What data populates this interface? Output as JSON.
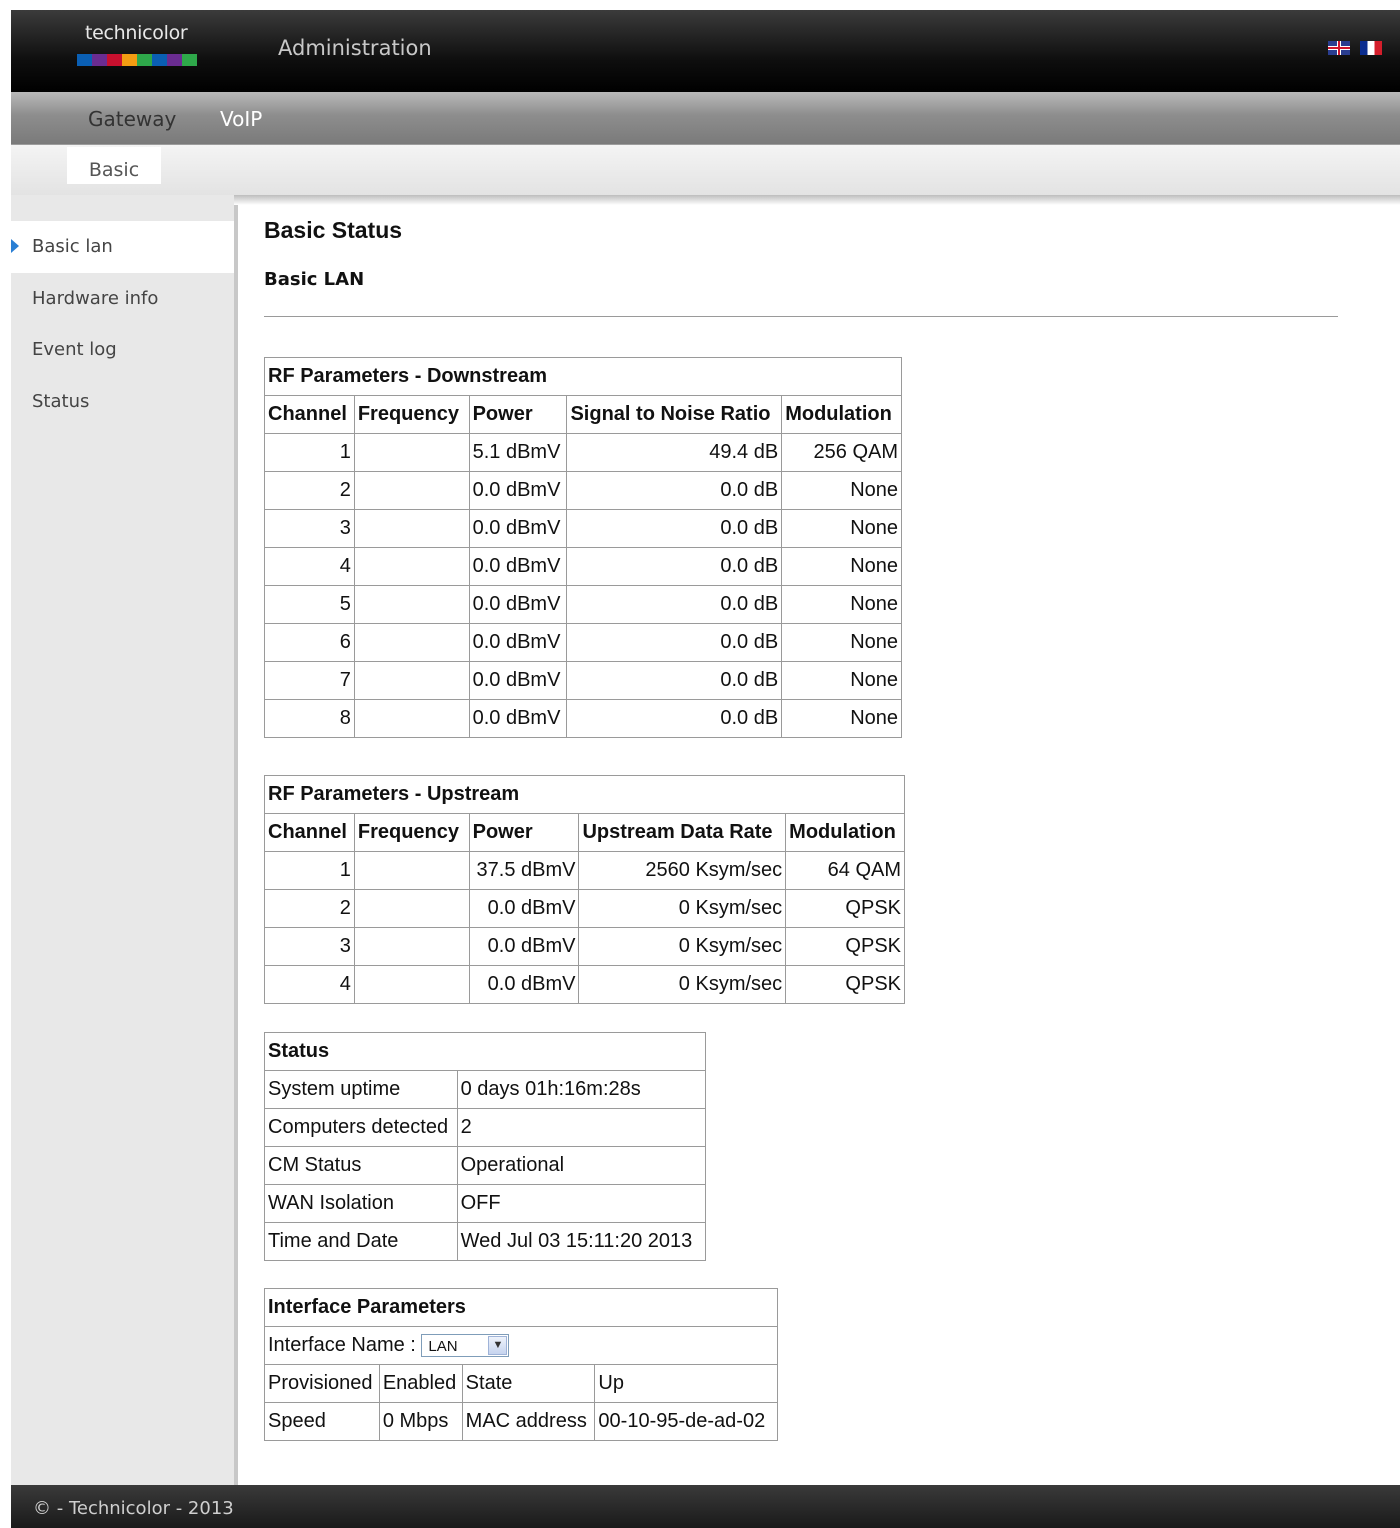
{
  "header": {
    "logo_text": "technicolor",
    "app_title": "Administration",
    "languages": [
      "English",
      "Français"
    ]
  },
  "nav": {
    "top_items": [
      {
        "label": "Gateway"
      },
      {
        "label": "VoIP"
      }
    ],
    "sub_tab": "Basic"
  },
  "sidebar": {
    "items": [
      {
        "label": "Basic lan",
        "active": true
      },
      {
        "label": "Hardware info"
      },
      {
        "label": "Event log"
      },
      {
        "label": "Status"
      }
    ]
  },
  "page": {
    "title": "Basic Status",
    "subtitle": "Basic LAN"
  },
  "downstream": {
    "title": "RF Parameters - Downstream",
    "headers": [
      "Channel",
      "Frequency",
      "Power",
      "Signal to Noise Ratio",
      "Modulation"
    ],
    "rows": [
      [
        "1",
        "",
        "5.1 dBmV",
        "49.4 dB",
        "256 QAM"
      ],
      [
        "2",
        "",
        "0.0 dBmV",
        "0.0 dB",
        "None"
      ],
      [
        "3",
        "",
        "0.0 dBmV",
        "0.0 dB",
        "None"
      ],
      [
        "4",
        "",
        "0.0 dBmV",
        "0.0 dB",
        "None"
      ],
      [
        "5",
        "",
        "0.0 dBmV",
        "0.0 dB",
        "None"
      ],
      [
        "6",
        "",
        "0.0 dBmV",
        "0.0 dB",
        "None"
      ],
      [
        "7",
        "",
        "0.0 dBmV",
        "0.0 dB",
        "None"
      ],
      [
        "8",
        "",
        "0.0 dBmV",
        "0.0 dB",
        "None"
      ]
    ]
  },
  "upstream": {
    "title": "RF Parameters - Upstream",
    "headers": [
      "Channel",
      "Frequency",
      "Power",
      "Upstream Data Rate",
      "Modulation"
    ],
    "rows": [
      [
        "1",
        "",
        "37.5 dBmV",
        "2560 Ksym/sec",
        "64 QAM"
      ],
      [
        "2",
        "",
        "0.0 dBmV",
        "0 Ksym/sec",
        "QPSK"
      ],
      [
        "3",
        "",
        "0.0 dBmV",
        "0 Ksym/sec",
        "QPSK"
      ],
      [
        "4",
        "",
        "0.0 dBmV",
        "0 Ksym/sec",
        "QPSK"
      ]
    ]
  },
  "status": {
    "title": "Status",
    "rows": [
      [
        "System uptime",
        "0 days 01h:16m:28s"
      ],
      [
        "Computers detected",
        "2"
      ],
      [
        "CM Status",
        "Operational"
      ],
      [
        "WAN Isolation",
        "OFF"
      ],
      [
        "Time and Date",
        "Wed Jul 03 15:11:20 2013"
      ]
    ]
  },
  "interface": {
    "title": "Interface Parameters",
    "name_label": "Interface Name :",
    "name_value": "LAN",
    "row1": [
      "Provisioned",
      "Enabled",
      "State",
      "Up"
    ],
    "row2": [
      "Speed",
      "0 Mbps",
      "MAC address",
      "00-10-95-de-ad-02"
    ]
  },
  "footer": {
    "text": "© - Technicolor - 2013"
  },
  "colors": {
    "accent_arrow": "#2a7fd4",
    "header_bg": "#000000",
    "logo_bar": [
      "#0a5fb4",
      "#6a2c91",
      "#c8102e",
      "#f39c12",
      "#2ea84a",
      "#0a5fb4",
      "#6a2c91",
      "#2ea84a"
    ]
  }
}
